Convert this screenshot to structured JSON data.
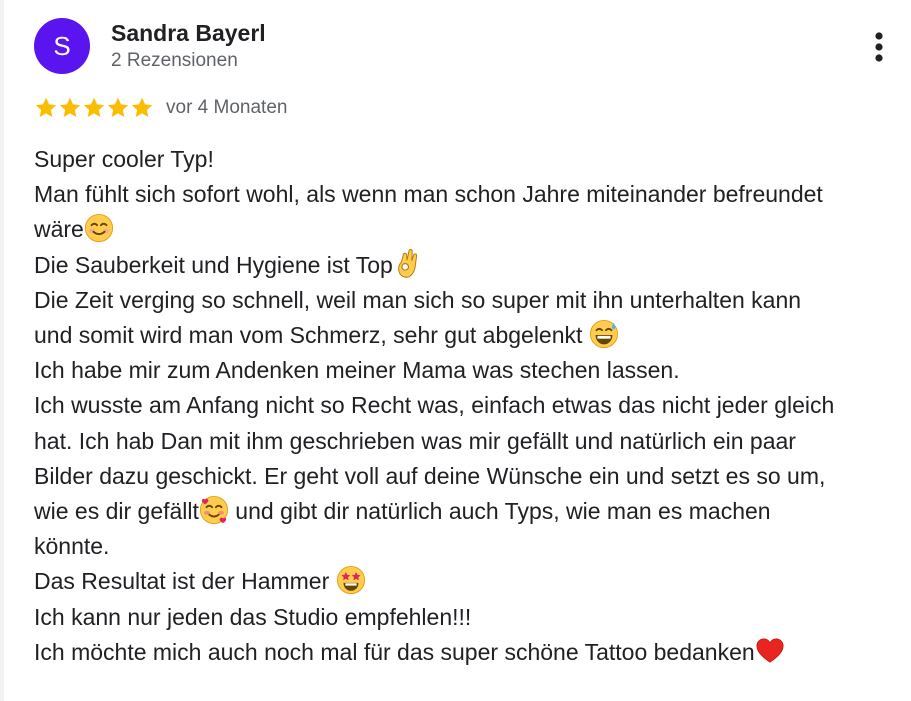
{
  "review": {
    "author": {
      "name": "Sandra Bayerl",
      "initial": "S",
      "review_count": "2 Rezensionen",
      "avatar_color": "#5a14f0"
    },
    "rating": 5,
    "rating_max": 5,
    "star_color": "#fbbc04",
    "date": "vor 4 Monaten",
    "more_options_icon": "more-vert-icon",
    "lines": [
      {
        "text": "Super cooler Typ!",
        "emoji": null
      },
      {
        "text": "Man fühlt sich sofort wohl, als wenn man schon Jahre miteinander befreundet",
        "emoji": null
      },
      {
        "text": "wäre",
        "emoji": "smiling-face-icon"
      },
      {
        "text": "Die Sauberkeit und Hygiene ist Top",
        "emoji": "ok-hand-icon"
      },
      {
        "text": "Die Zeit verging so schnell, weil man sich so super mit ihn unterhalten kann",
        "emoji": null
      },
      {
        "text": "und somit wird man vom Schmerz, sehr gut abgelenkt ",
        "emoji": "grinning-sweat-icon"
      },
      {
        "text": "Ich habe mir zum Andenken meiner Mama was stechen lassen.",
        "emoji": null
      },
      {
        "text": "Ich wusste am Anfang nicht so Recht was, einfach etwas das nicht jeder gleich",
        "emoji": null
      },
      {
        "text": "hat. Ich hab Dan mit ihm geschrieben was mir gefällt und natürlich ein paar",
        "emoji": null
      },
      {
        "text": "Bilder dazu geschickt. Er geht voll auf deine Wünsche ein und setzt es so um,",
        "emoji": null
      },
      {
        "text": "wie es dir gefällt",
        "emoji": "smiling-hearts-icon",
        "after": " und gibt dir natürlich auch Typs, wie man es machen"
      },
      {
        "text": "könnte.",
        "emoji": null
      },
      {
        "text": "Das Resultat ist der Hammer ",
        "emoji": "star-struck-icon"
      },
      {
        "text": "Ich kann nur jeden das Studio empfehlen!!!",
        "emoji": null
      },
      {
        "text": "Ich möchte mich auch noch mal für das super schöne Tattoo bedanken",
        "emoji": "red-heart-icon"
      }
    ]
  }
}
